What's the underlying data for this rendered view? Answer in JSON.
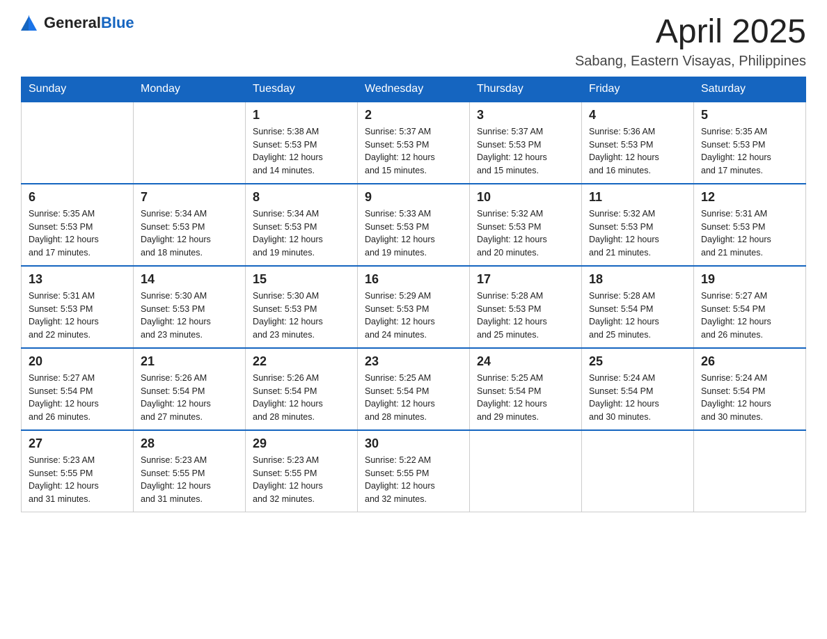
{
  "logo": {
    "general": "General",
    "blue": "Blue"
  },
  "header": {
    "title": "April 2025",
    "subtitle": "Sabang, Eastern Visayas, Philippines"
  },
  "weekdays": [
    "Sunday",
    "Monday",
    "Tuesday",
    "Wednesday",
    "Thursday",
    "Friday",
    "Saturday"
  ],
  "weeks": [
    [
      {
        "day": "",
        "info": ""
      },
      {
        "day": "",
        "info": ""
      },
      {
        "day": "1",
        "info": "Sunrise: 5:38 AM\nSunset: 5:53 PM\nDaylight: 12 hours\nand 14 minutes."
      },
      {
        "day": "2",
        "info": "Sunrise: 5:37 AM\nSunset: 5:53 PM\nDaylight: 12 hours\nand 15 minutes."
      },
      {
        "day": "3",
        "info": "Sunrise: 5:37 AM\nSunset: 5:53 PM\nDaylight: 12 hours\nand 15 minutes."
      },
      {
        "day": "4",
        "info": "Sunrise: 5:36 AM\nSunset: 5:53 PM\nDaylight: 12 hours\nand 16 minutes."
      },
      {
        "day": "5",
        "info": "Sunrise: 5:35 AM\nSunset: 5:53 PM\nDaylight: 12 hours\nand 17 minutes."
      }
    ],
    [
      {
        "day": "6",
        "info": "Sunrise: 5:35 AM\nSunset: 5:53 PM\nDaylight: 12 hours\nand 17 minutes."
      },
      {
        "day": "7",
        "info": "Sunrise: 5:34 AM\nSunset: 5:53 PM\nDaylight: 12 hours\nand 18 minutes."
      },
      {
        "day": "8",
        "info": "Sunrise: 5:34 AM\nSunset: 5:53 PM\nDaylight: 12 hours\nand 19 minutes."
      },
      {
        "day": "9",
        "info": "Sunrise: 5:33 AM\nSunset: 5:53 PM\nDaylight: 12 hours\nand 19 minutes."
      },
      {
        "day": "10",
        "info": "Sunrise: 5:32 AM\nSunset: 5:53 PM\nDaylight: 12 hours\nand 20 minutes."
      },
      {
        "day": "11",
        "info": "Sunrise: 5:32 AM\nSunset: 5:53 PM\nDaylight: 12 hours\nand 21 minutes."
      },
      {
        "day": "12",
        "info": "Sunrise: 5:31 AM\nSunset: 5:53 PM\nDaylight: 12 hours\nand 21 minutes."
      }
    ],
    [
      {
        "day": "13",
        "info": "Sunrise: 5:31 AM\nSunset: 5:53 PM\nDaylight: 12 hours\nand 22 minutes."
      },
      {
        "day": "14",
        "info": "Sunrise: 5:30 AM\nSunset: 5:53 PM\nDaylight: 12 hours\nand 23 minutes."
      },
      {
        "day": "15",
        "info": "Sunrise: 5:30 AM\nSunset: 5:53 PM\nDaylight: 12 hours\nand 23 minutes."
      },
      {
        "day": "16",
        "info": "Sunrise: 5:29 AM\nSunset: 5:53 PM\nDaylight: 12 hours\nand 24 minutes."
      },
      {
        "day": "17",
        "info": "Sunrise: 5:28 AM\nSunset: 5:53 PM\nDaylight: 12 hours\nand 25 minutes."
      },
      {
        "day": "18",
        "info": "Sunrise: 5:28 AM\nSunset: 5:54 PM\nDaylight: 12 hours\nand 25 minutes."
      },
      {
        "day": "19",
        "info": "Sunrise: 5:27 AM\nSunset: 5:54 PM\nDaylight: 12 hours\nand 26 minutes."
      }
    ],
    [
      {
        "day": "20",
        "info": "Sunrise: 5:27 AM\nSunset: 5:54 PM\nDaylight: 12 hours\nand 26 minutes."
      },
      {
        "day": "21",
        "info": "Sunrise: 5:26 AM\nSunset: 5:54 PM\nDaylight: 12 hours\nand 27 minutes."
      },
      {
        "day": "22",
        "info": "Sunrise: 5:26 AM\nSunset: 5:54 PM\nDaylight: 12 hours\nand 28 minutes."
      },
      {
        "day": "23",
        "info": "Sunrise: 5:25 AM\nSunset: 5:54 PM\nDaylight: 12 hours\nand 28 minutes."
      },
      {
        "day": "24",
        "info": "Sunrise: 5:25 AM\nSunset: 5:54 PM\nDaylight: 12 hours\nand 29 minutes."
      },
      {
        "day": "25",
        "info": "Sunrise: 5:24 AM\nSunset: 5:54 PM\nDaylight: 12 hours\nand 30 minutes."
      },
      {
        "day": "26",
        "info": "Sunrise: 5:24 AM\nSunset: 5:54 PM\nDaylight: 12 hours\nand 30 minutes."
      }
    ],
    [
      {
        "day": "27",
        "info": "Sunrise: 5:23 AM\nSunset: 5:55 PM\nDaylight: 12 hours\nand 31 minutes."
      },
      {
        "day": "28",
        "info": "Sunrise: 5:23 AM\nSunset: 5:55 PM\nDaylight: 12 hours\nand 31 minutes."
      },
      {
        "day": "29",
        "info": "Sunrise: 5:23 AM\nSunset: 5:55 PM\nDaylight: 12 hours\nand 32 minutes."
      },
      {
        "day": "30",
        "info": "Sunrise: 5:22 AM\nSunset: 5:55 PM\nDaylight: 12 hours\nand 32 minutes."
      },
      {
        "day": "",
        "info": ""
      },
      {
        "day": "",
        "info": ""
      },
      {
        "day": "",
        "info": ""
      }
    ]
  ]
}
